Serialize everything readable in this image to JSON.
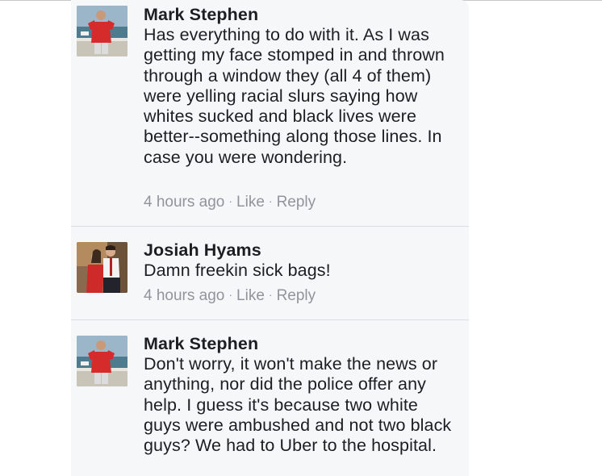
{
  "comments": [
    {
      "author": "Mark Stephen",
      "text": "Has everything to do with it. As I was getting my face stomped in and thrown through a window they (all 4 of them) were yelling racial slurs saying how whites sucked and black lives were better--something along those lines. In case you were wondering.",
      "time": "4 hours ago",
      "like_label": "Like",
      "reply_label": "Reply"
    },
    {
      "author": "Josiah Hyams",
      "text": "Damn freekin sick bags!",
      "time": "4 hours ago",
      "like_label": "Like",
      "reply_label": "Reply"
    },
    {
      "author": "Mark Stephen",
      "text": "Don't worry, it won't make the news or anything, nor did the police offer any help. I guess it's because two white guys were ambushed and not two black guys? We had to Uber to the hospital."
    }
  ],
  "separator": "·"
}
